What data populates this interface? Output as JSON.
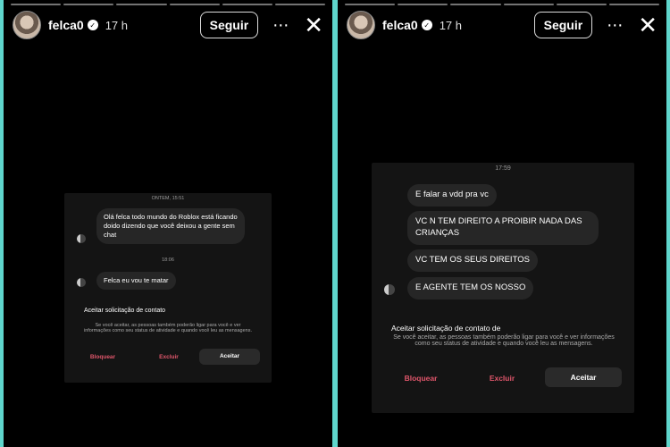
{
  "story_left": {
    "username": "felca0",
    "time": "17 h",
    "follow_label": "Seguir",
    "more_icon": "⋯",
    "close_icon": "✕",
    "chat": {
      "timestamp1": "ONTEM, 15:51",
      "message1": "Olá felca todo mundo do Roblox está ficando doido dizendo que você deixou a gente sem chat",
      "timestamp2": "18:06",
      "message2": "Felca eu vou te matar",
      "request_title": "Aceitar solicitação de contato",
      "request_desc": "Se você aceitar, as pessoas também poderão ligar para você e ver informações como seu status de atividade e quando você leu as mensagens.",
      "block_label": "Bloquear",
      "delete_label": "Excluir",
      "accept_label": "Aceitar"
    }
  },
  "story_right": {
    "username": "felca0",
    "time": "17 h",
    "follow_label": "Seguir",
    "more_icon": "⋯",
    "close_icon": "✕",
    "chat": {
      "timestamp": "17:59",
      "messages": [
        "E falar a vdd pra vc",
        "VC N TEM DIREITO A PROIBIR NADA DAS CRIANÇAS",
        "VC TEM OS SEUS DIREITOS",
        "E AGENTE TEM OS NOSSO"
      ],
      "request_title": "Aceitar solicitação de contato de",
      "request_desc": "Se você aceitar, as pessoas também poderão ligar para você e ver informações como seu status de atividade e quando você leu as mensagens.",
      "block_label": "Bloquear",
      "delete_label": "Excluir",
      "accept_label": "Aceitar"
    }
  }
}
